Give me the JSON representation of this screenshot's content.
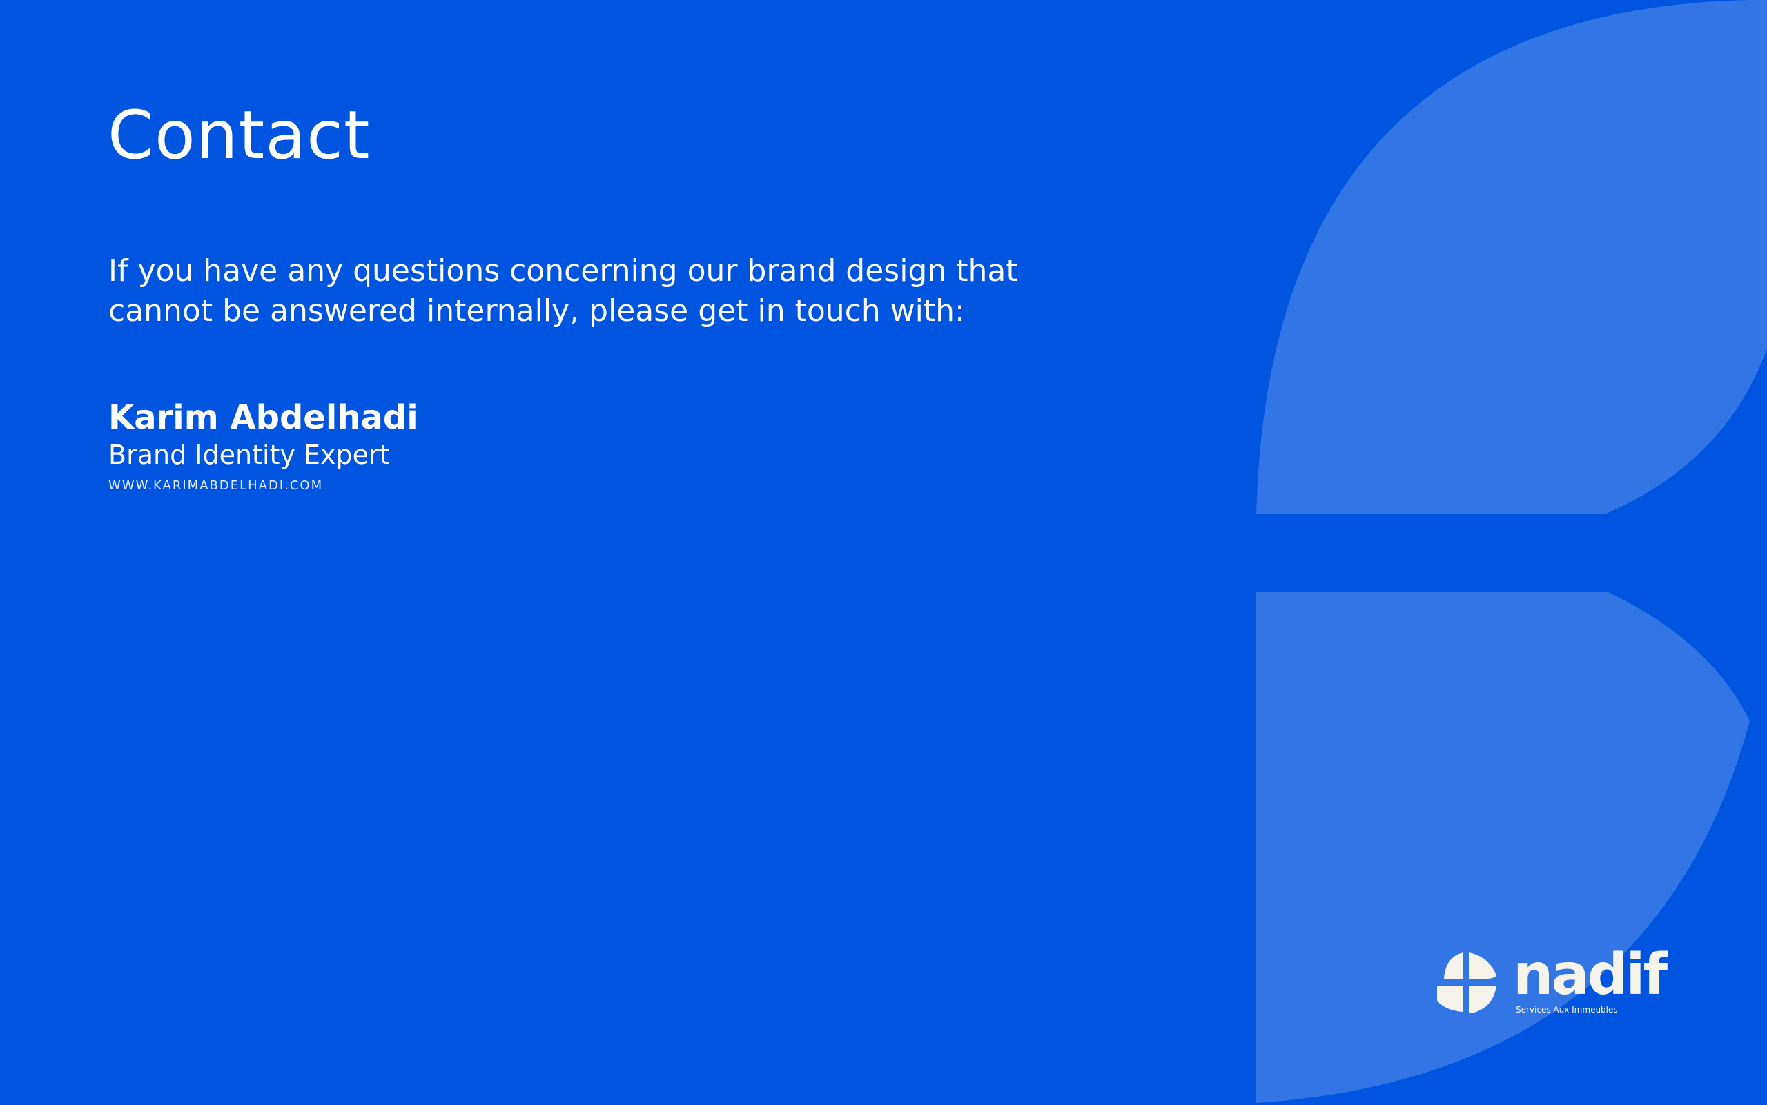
{
  "page": {
    "title": "Contact",
    "intro_line_1": "If you have any questions concerning our brand design that",
    "intro_line_2": "cannot be answered internally, please get in touch with:"
  },
  "contact": {
    "name": "Karim Abdelhadi",
    "role": "Brand Identity Expert",
    "website": "WWW.KARIMABDELHADI.COM"
  },
  "logo": {
    "wordmark": "nadif",
    "tagline": "Services Aux Immeubles"
  },
  "colors": {
    "background": "#0055e0",
    "shape": "#3276e6",
    "text": "#ffffff",
    "logo": "#f6f3ea"
  }
}
